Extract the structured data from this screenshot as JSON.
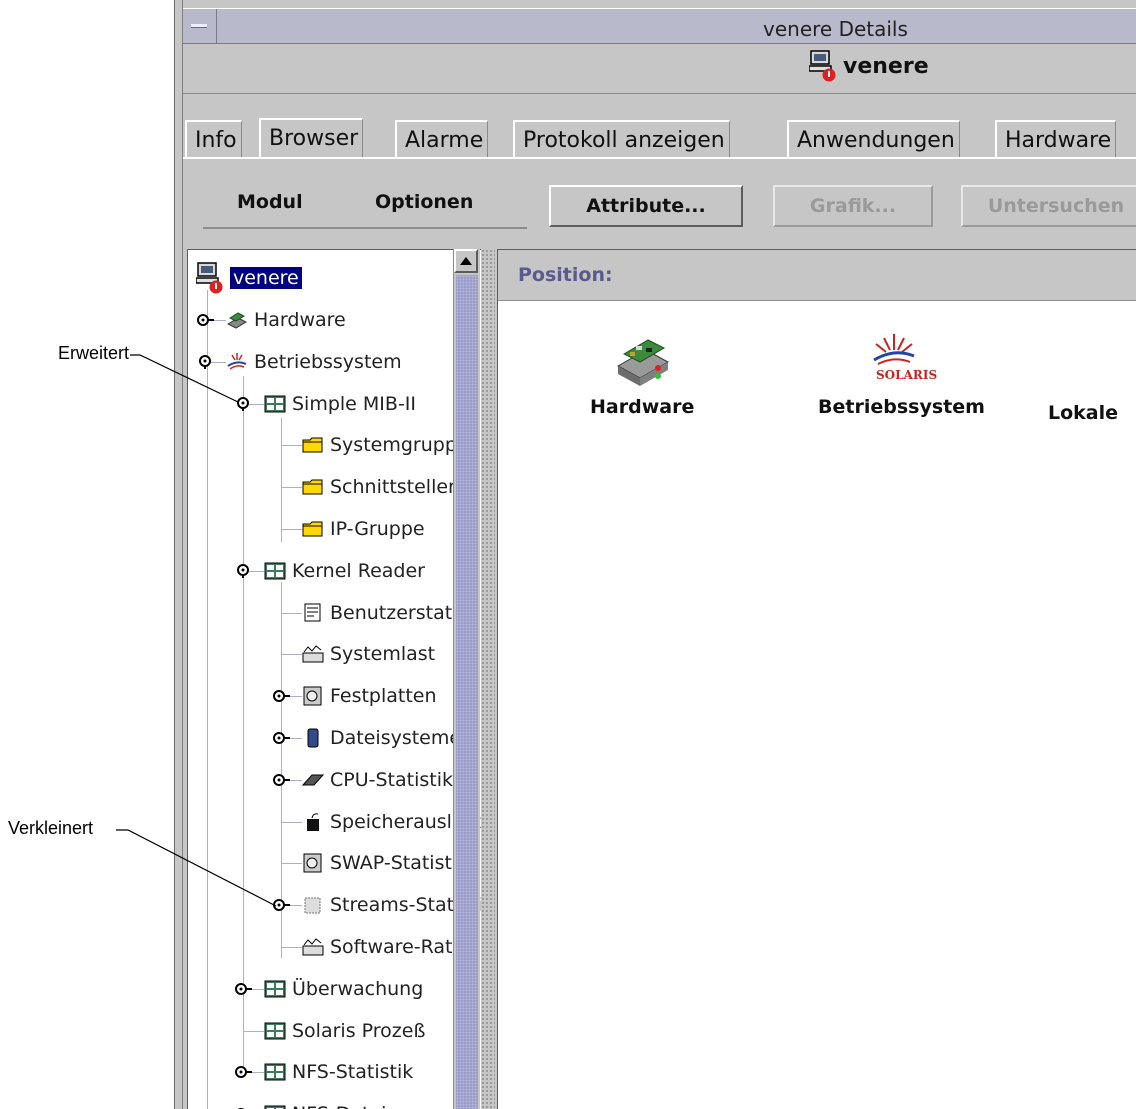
{
  "window": {
    "title": "venere Details",
    "host_name": "venere"
  },
  "tabs": [
    {
      "label": "Info",
      "active": false
    },
    {
      "label": "Browser",
      "active": true
    },
    {
      "label": "Alarme",
      "active": false
    },
    {
      "label": "Protokoll anzeigen",
      "active": false
    },
    {
      "label": "Anwendungen",
      "active": false
    },
    {
      "label": "Hardware",
      "active": false
    }
  ],
  "toolbar": {
    "menu_modul": "Modul",
    "menu_optionen": "Optionen",
    "attribute_label": "Attribute...",
    "grafik_label": "Grafik...",
    "untersuchen_label": "Untersuchen"
  },
  "tree": {
    "root": "venere",
    "items": [
      {
        "label": "Hardware",
        "icon": "hardware-icon",
        "expander": "collapsed"
      },
      {
        "label": "Betriebssystem",
        "icon": "solaris-icon",
        "expander": "expanded"
      },
      {
        "label": "Simple MIB-II",
        "icon": "module-icon",
        "expander": "expanded"
      },
      {
        "label": "Systemgruppe",
        "icon": "folder-icon",
        "expander": "none"
      },
      {
        "label": "Schnittstellen",
        "icon": "folder-icon",
        "expander": "none"
      },
      {
        "label": "IP-Gruppe",
        "icon": "folder-icon",
        "expander": "none"
      },
      {
        "label": "Kernel Reader",
        "icon": "module-icon",
        "expander": "expanded"
      },
      {
        "label": "Benutzerstatistik",
        "icon": "user-stats-icon",
        "expander": "none"
      },
      {
        "label": "Systemlast",
        "icon": "load-icon",
        "expander": "none"
      },
      {
        "label": "Festplatten",
        "icon": "disk-icon",
        "expander": "collapsed"
      },
      {
        "label": "Dateisysteme",
        "icon": "filesystem-icon",
        "expander": "collapsed"
      },
      {
        "label": "CPU-Statistik",
        "icon": "cpu-icon",
        "expander": "collapsed"
      },
      {
        "label": "Speicherauslastung",
        "icon": "memory-icon",
        "expander": "none"
      },
      {
        "label": "SWAP-Statistik",
        "icon": "disk-icon",
        "expander": "none"
      },
      {
        "label": "Streams-Statistik",
        "icon": "chip-icon",
        "expander": "collapsed"
      },
      {
        "label": "Software-Rate",
        "icon": "load-icon",
        "expander": "none"
      },
      {
        "label": "Überwachung",
        "icon": "module-icon",
        "expander": "collapsed"
      },
      {
        "label": "Solaris Prozeß",
        "icon": "module-icon",
        "expander": "none"
      },
      {
        "label": "NFS-Statistik",
        "icon": "module-icon",
        "expander": "collapsed"
      },
      {
        "label": "NFS-Datei",
        "icon": "module-icon",
        "expander": "collapsed"
      }
    ]
  },
  "content": {
    "position_label": "Position:",
    "modules": [
      {
        "label": "Hardware",
        "icon": "hardware-board-icon"
      },
      {
        "label": "Betriebssystem",
        "icon": "solaris-logo-icon",
        "logo_text": "SOLARIS"
      },
      {
        "label": "Lokale",
        "icon": ""
      }
    ]
  },
  "callouts": {
    "expanded": "Erweitert",
    "collapsed": "Verkleinert"
  },
  "colors": {
    "selection": "#000080",
    "position_text": "#5a5a8c",
    "title_bar": "#b9b9cc",
    "scroll_thumb": "#9c9cc8",
    "solaris_red": "#cc2222"
  }
}
